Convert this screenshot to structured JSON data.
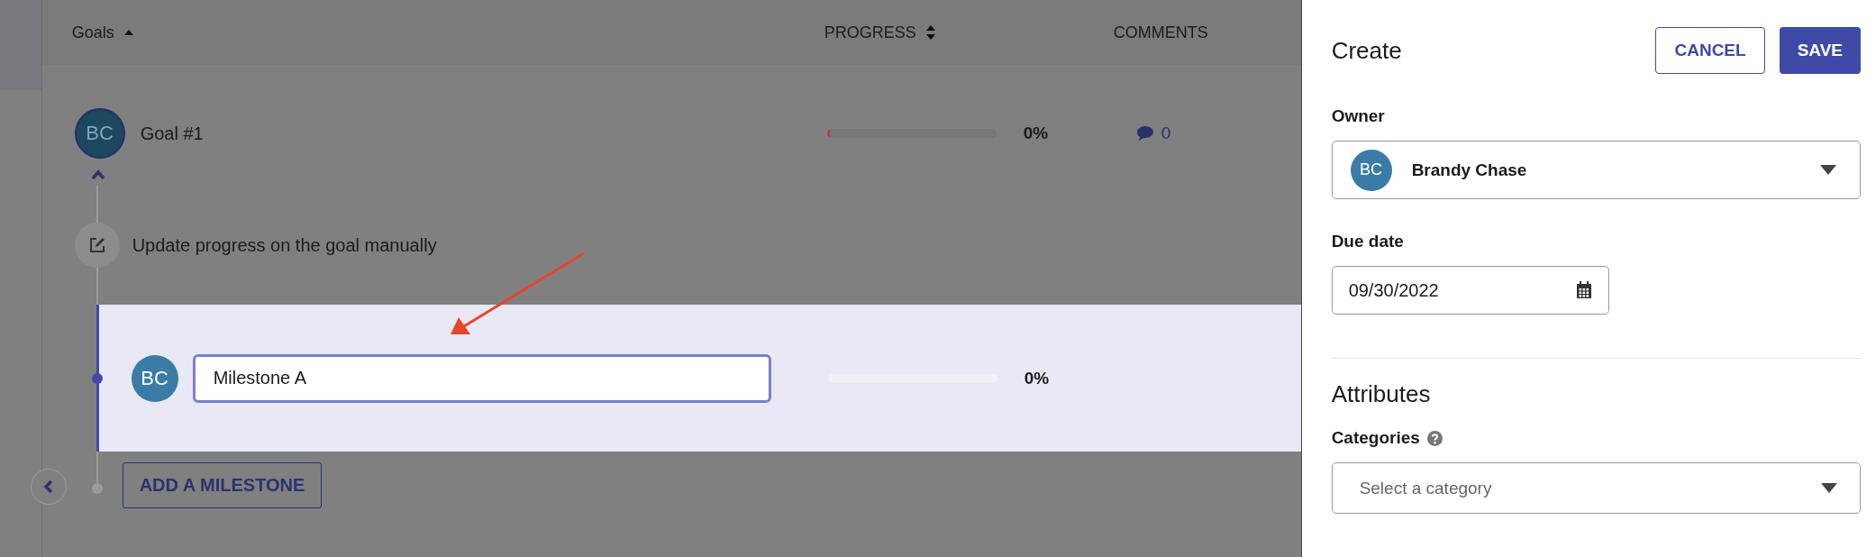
{
  "table": {
    "columns": [
      {
        "label": "Goals",
        "sortable": true,
        "sorted": true
      },
      {
        "label": "PROGRESS",
        "sortable": true,
        "sorted": false
      },
      {
        "label": "COMMENTS",
        "sortable": false
      }
    ]
  },
  "goal": {
    "avatar": "BC",
    "name": "Goal #1",
    "level": 0,
    "percent": "0%",
    "comments": "0",
    "expanded": true
  },
  "method": {
    "text": "Update progress on the goal manually"
  },
  "milestones": [
    {
      "avatar": "BC",
      "value": "Milestone A",
      "level": 0,
      "percent": "0%",
      "selected": true
    }
  ],
  "add_milestone": "ADD A MILESTONE",
  "panel": {
    "title": "Create",
    "cancel": "CANCEL",
    "save": "SAVE",
    "owner": {
      "label": "Owner",
      "avatar": "BC",
      "value": "Brandy Chase"
    },
    "due_date": {
      "label": "Due date",
      "value": "09/30/2022"
    },
    "section": "Attributes",
    "categories": {
      "label": "Categories",
      "placeholder": "Select a category"
    }
  }
}
